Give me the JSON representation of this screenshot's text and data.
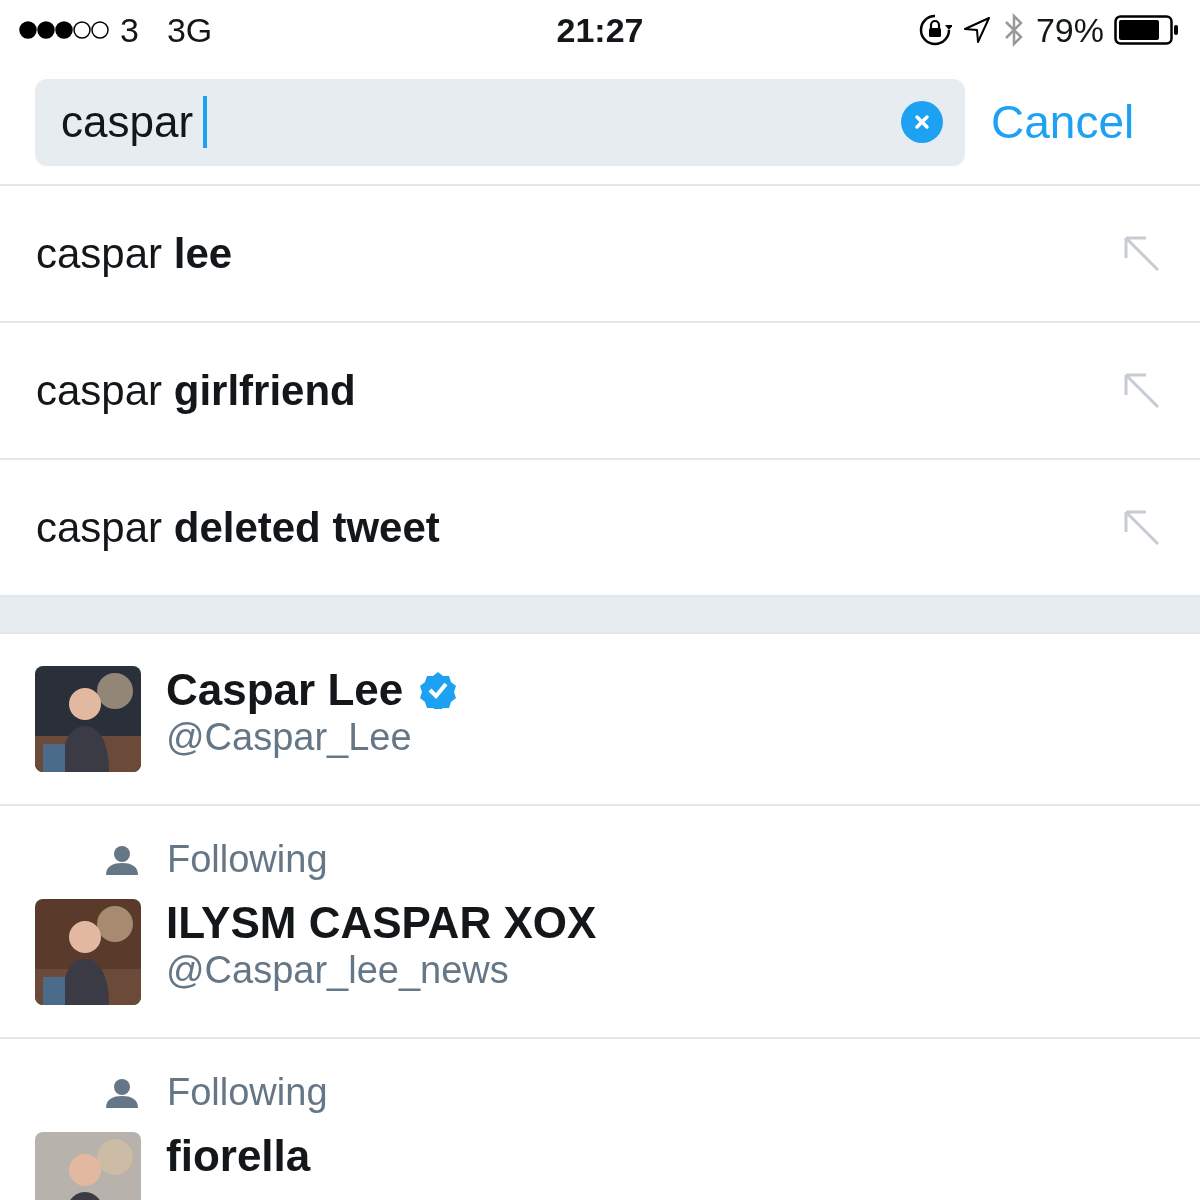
{
  "status_bar": {
    "carrier": "3",
    "network": "3G",
    "time": "21:27",
    "battery": "79%"
  },
  "search": {
    "value": "caspar",
    "cancel": "Cancel"
  },
  "suggestions": [
    {
      "text": "caspar **lee**"
    },
    {
      "text": "caspar **girlfriend**"
    },
    {
      "text": "caspar **deleted tweet**"
    }
  ],
  "users": [
    {
      "name": "Caspar Lee",
      "handle": "@Caspar_Lee",
      "verified": true,
      "following": false
    },
    {
      "name": "ILYSM CASPAR XOX",
      "handle": "@Caspar_lee_news",
      "verified": false,
      "following": true,
      "context": "Following"
    },
    {
      "name": "fiorella",
      "verified": false,
      "following": true,
      "context": "Following"
    }
  ]
}
